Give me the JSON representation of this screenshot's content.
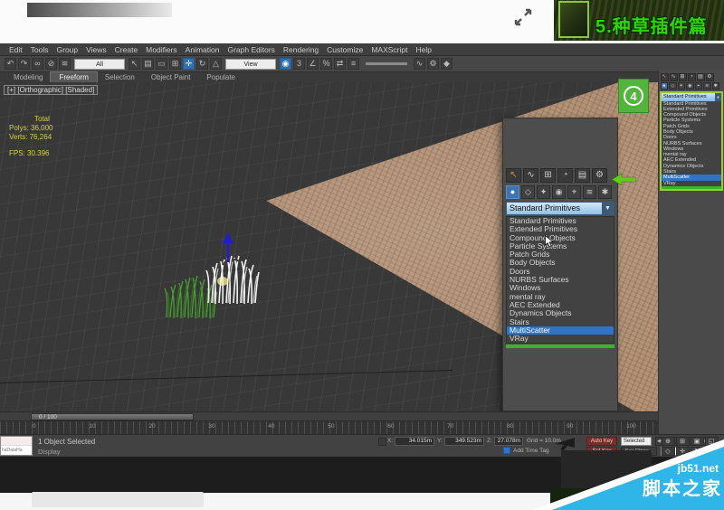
{
  "header": {
    "title": "5.种草插件篇"
  },
  "menu_bar": {
    "items": [
      "Edit",
      "Tools",
      "Group",
      "Views",
      "Create",
      "Modifiers",
      "Animation",
      "Graph Editors",
      "Rendering",
      "Customize",
      "MAXScript",
      "Help"
    ]
  },
  "toolbar": {
    "items": [
      {
        "name": "undo-icon",
        "glyph": "↶"
      },
      {
        "name": "redo-icon",
        "glyph": "↷"
      },
      {
        "name": "select-and-link-icon",
        "glyph": "∞"
      },
      {
        "name": "unlink-selection-icon",
        "glyph": "⊘"
      },
      {
        "name": "bind-to-space-warp-icon",
        "glyph": "≋"
      },
      {
        "name": "selection-filter-dropdown",
        "label": "All",
        "cls": "tb-combo"
      },
      {
        "name": "select-object-icon",
        "glyph": "↖"
      },
      {
        "name": "select-by-name-icon",
        "glyph": "▤"
      },
      {
        "name": "rectangular-selection-region-icon",
        "glyph": "▭"
      },
      {
        "name": "window-crossing-icon",
        "glyph": "⊞"
      },
      {
        "name": "select-and-move-icon",
        "glyph": "✛",
        "cls": "active"
      },
      {
        "name": "select-and-rotate-icon",
        "glyph": "↻"
      },
      {
        "name": "select-and-scale-icon",
        "glyph": "△"
      },
      {
        "name": "reference-coordinate-dropdown",
        "label": "View",
        "cls": "tb-combo"
      },
      {
        "name": "use-pivot-point-icon",
        "glyph": "◉",
        "cls": "active"
      },
      {
        "name": "snap-toggle-icon",
        "glyph": "3"
      },
      {
        "name": "angle-snap-icon",
        "glyph": "∠"
      },
      {
        "name": "percent-snap-icon",
        "glyph": "%"
      },
      {
        "name": "mirror-icon",
        "glyph": "⇄"
      },
      {
        "name": "align-icon",
        "glyph": "≡"
      },
      {
        "name": "material-editor-slider",
        "glyph": "",
        "cls": "tb-slider"
      },
      {
        "name": "curve-editor-icon",
        "glyph": "∿"
      },
      {
        "name": "render-setup-icon",
        "glyph": "⚙"
      },
      {
        "name": "render-icon",
        "glyph": "◆"
      }
    ]
  },
  "ribbon": {
    "tabs": [
      "Modeling",
      "Freeform",
      "Selection",
      "Object Paint",
      "Populate"
    ],
    "active": "Freeform"
  },
  "viewport": {
    "label": "[+] [Orthographic] [Shaded]",
    "stats_header": "Total",
    "stats": [
      "Polys: 36,000",
      "Verts: 76,264",
      "FPS: 30.396"
    ]
  },
  "command_panel": {
    "tabs": [
      {
        "name": "create-tab-icon",
        "glyph": "↖"
      },
      {
        "name": "modify-tab-icon",
        "glyph": "∿"
      },
      {
        "name": "hierarchy-tab-icon",
        "glyph": "⊞"
      },
      {
        "name": "motion-tab-icon",
        "glyph": "◔"
      },
      {
        "name": "display-tab-icon",
        "glyph": "▤"
      },
      {
        "name": "utilities-tab-icon",
        "glyph": "⚙"
      }
    ],
    "categories": [
      {
        "name": "geometry-category-icon",
        "glyph": "●"
      },
      {
        "name": "shapes-category-icon",
        "glyph": "◇"
      },
      {
        "name": "lights-category-icon",
        "glyph": "✦"
      },
      {
        "name": "cameras-category-icon",
        "glyph": "◉"
      },
      {
        "name": "helpers-category-icon",
        "glyph": "⌖"
      },
      {
        "name": "space-warps-category-icon",
        "glyph": "≋"
      },
      {
        "name": "systems-category-icon",
        "glyph": "✱"
      }
    ],
    "dropdown": {
      "value": "Standard Primitives",
      "selected": "MultiScatter",
      "items": [
        "Standard Primitives",
        "Extended Primitives",
        "Compound Objects",
        "Particle Systems",
        "Patch Grids",
        "Body Objects",
        "Doors",
        "NURBS Surfaces",
        "Windows",
        "mental ray",
        "AEC Extended",
        "Dynamics Objects",
        "Stairs",
        "MultiScatter",
        "VRay"
      ]
    }
  },
  "annotations": {
    "step_number": "4"
  },
  "timeline": {
    "slider_label": "0 / 100",
    "ticks": [
      "0",
      "10",
      "20",
      "30",
      "40",
      "50",
      "60",
      "70",
      "80",
      "90",
      "100"
    ]
  },
  "status_bar": {
    "mini_listener_text": "haDataHa",
    "selection_text": "1 Object Selected",
    "prompt_text": "Display",
    "coords": {
      "x_label": "X:",
      "x": "34.015m",
      "y_label": "Y:",
      "y": "349.523m",
      "z_label": "Z:",
      "z": "27.078m"
    },
    "grid_text": "Grid = 10.0m",
    "auto_key": "Auto Key",
    "set_key": "Set Key",
    "selected_combo": "Selected",
    "key_filters": "Key Filters...",
    "add_time_tag": "Add Time Tag",
    "time_value": "0",
    "transport": [
      {
        "name": "go-to-start-button",
        "glyph": "◀◀"
      },
      {
        "name": "previous-frame-button",
        "glyph": "◀"
      },
      {
        "name": "play-button",
        "glyph": "▶"
      },
      {
        "name": "next-frame-button",
        "glyph": "▶"
      },
      {
        "name": "go-to-end-button",
        "glyph": "▶▶"
      }
    ],
    "nav_icons": [
      {
        "name": "zoom-icon",
        "glyph": "⊕"
      },
      {
        "name": "zoom-all-icon",
        "glyph": "⊞"
      },
      {
        "name": "zoom-extents-icon",
        "glyph": "▣"
      },
      {
        "name": "zoom-region-icon",
        "glyph": "◱"
      },
      {
        "name": "fov-icon",
        "glyph": "◇"
      },
      {
        "name": "pan-icon",
        "glyph": "✛"
      },
      {
        "name": "orbit-icon",
        "glyph": "↻"
      },
      {
        "name": "maximize-viewport-icon",
        "glyph": "▭"
      }
    ]
  },
  "watermark": {
    "site": "jb51.net",
    "name": "脚本之家"
  },
  "colors": {
    "title_green": "#2fd409",
    "badge_green": "#52b43c",
    "highlight_blue": "#2e74c8",
    "outline_green": "#9ccb2f",
    "watermark_blue": "#2fb5e8",
    "terrain_tan": "#b29176",
    "autokey_red": "#7a2d2d"
  }
}
